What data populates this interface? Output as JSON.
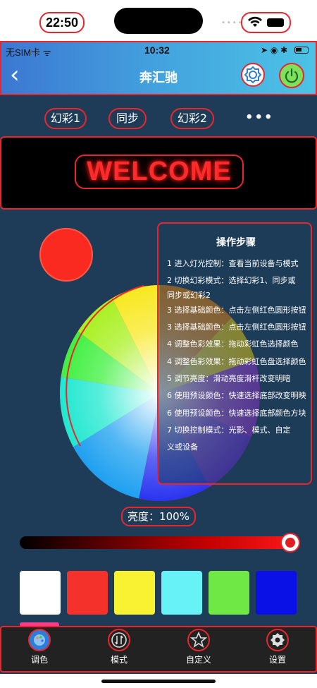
{
  "device": {
    "time": "22:50"
  },
  "app_status": {
    "carrier": "无SIM卡",
    "time": "10:32"
  },
  "header": {
    "title": "奔汇驰"
  },
  "tabs": [
    "幻彩1",
    "同步",
    "幻彩2"
  ],
  "more_label": "•••",
  "display": {
    "text": "WELCOME"
  },
  "steps": {
    "title": "操作步骤",
    "items": [
      "1  进入灯光控制：查看当前设备与模式",
      "2  切换幻彩模式：选择幻彩1、同步或",
      "    同步或幻彩2",
      "3  选择基础颜色：点击左侧红色圆形按钮",
      "3  选择基础颜色：点击左侧红色圆形按钮",
      "4  调整色彩效果：拖动彩虹色选择颜色",
      "4  调整色彩效果：拖动彩虹色盘选择颜色",
      "5  调节亮度：滑动亮度滑杆改变明暗",
      "6  使用预设颜色：快速选择底部改变明映",
      "6  使用预设颜色：快速选择底部颜色方块",
      "7  切换控制模式：光影、模式、自定",
      "    义或设备"
    ]
  },
  "brightness": {
    "label": "亮度：100%",
    "value_percent": 100
  },
  "swatches": [
    "#ffffff",
    "#f5312b",
    "#f8f233",
    "#66f2f7",
    "#6fe845",
    "#0a11e6"
  ],
  "nav": {
    "items": [
      {
        "label": "调色",
        "icon": "palette-icon"
      },
      {
        "label": "模式",
        "icon": "mode-icon"
      },
      {
        "label": "自定义",
        "icon": "custom-star-icon"
      },
      {
        "label": "设置",
        "icon": "settings-icon"
      }
    ]
  },
  "colors": {
    "accent_red": "#e8262c",
    "header_start": "#3c78d2",
    "header_end": "#4cc3e6",
    "background": "#1e3c58"
  }
}
